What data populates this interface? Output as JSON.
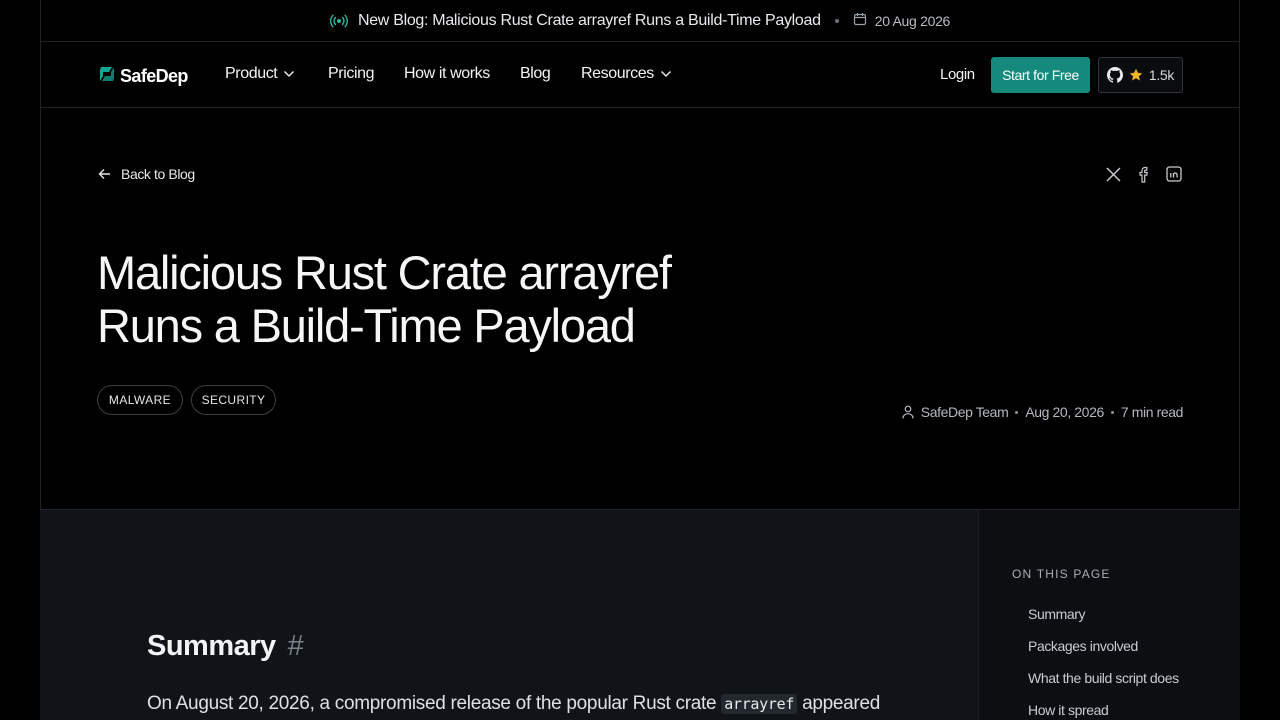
{
  "announcement": {
    "text": "New Blog: Malicious Rust Crate arrayref Runs a Build-Time Payload",
    "date": "20 Aug 2026"
  },
  "nav": {
    "logo": "SafeDep",
    "items": [
      {
        "label": "Product",
        "dropdown": true
      },
      {
        "label": "Pricing"
      },
      {
        "label": "How it works"
      },
      {
        "label": "Blog"
      },
      {
        "label": "Resources",
        "dropdown": true
      }
    ],
    "login": "Login",
    "cta": "Start for Free",
    "github_stars": "1.5k"
  },
  "post": {
    "back": "Back to Blog",
    "title_line1": "Malicious Rust Crate arrayref",
    "title_line2": "Runs a Build-Time Payload",
    "tags": [
      "MALWARE",
      "SECURITY"
    ],
    "author": "SafeDep Team",
    "date": "Aug 20, 2026",
    "read_time": "7 min read",
    "share_icons": [
      "x-icon",
      "facebook-icon",
      "linkedin-icon"
    ]
  },
  "article": {
    "heading": "Summary",
    "heading_anchor": "#",
    "para_before": "On August 20, 2026, a compromised release of the popular Rust crate",
    "para_code": "arrayref",
    "para_after": "appeared"
  },
  "toc": {
    "heading": "ON THIS PAGE",
    "items": [
      "Summary",
      "Packages involved",
      "What the build script does",
      "How it spread"
    ]
  },
  "colors": {
    "accent": "#14897c",
    "background": "#000000",
    "content_bg": "#101318",
    "star": "#f0b429"
  }
}
